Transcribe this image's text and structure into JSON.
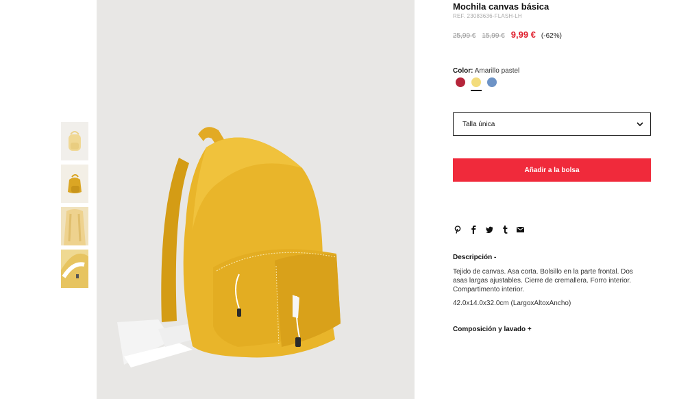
{
  "product": {
    "title": "Mochila canvas básica",
    "ref": "REF. 23083636-FLASH-LH",
    "price_original": "25,99 €",
    "price_previous": "15,99 €",
    "price_current": "9,99 €",
    "discount": "(-62%)"
  },
  "color": {
    "label": "Color:",
    "selected": "Amarillo pastel",
    "swatches": [
      {
        "name": "red",
        "hex": "#b5253a"
      },
      {
        "name": "yellow",
        "hex": "#f3dc7c",
        "selected": true
      },
      {
        "name": "blue",
        "hex": "#6d93c6"
      }
    ]
  },
  "size": {
    "selected": "Talla única",
    "icon": "chevron-down-icon"
  },
  "add_to_bag": "Añadir a la bolsa",
  "share": {
    "icons": [
      "pinterest-icon",
      "facebook-icon",
      "twitter-icon",
      "tumblr-icon",
      "email-icon"
    ]
  },
  "description": {
    "title": "Descripción -",
    "body": "Tejido de canvas. Asa corta. Bolsillo en la parte frontal. Dos asas largas ajustables. Cierre de cremallera. Forro interior. Compartimento interior.",
    "dimensions": "42.0x14.0x32.0cm (LargoxAltoxAncho)"
  },
  "composition": {
    "title": "Composición y lavado +"
  },
  "colors": {
    "accent": "#f02a3b",
    "price_sale": "#e0202e",
    "backpack": "#e9b52a"
  }
}
